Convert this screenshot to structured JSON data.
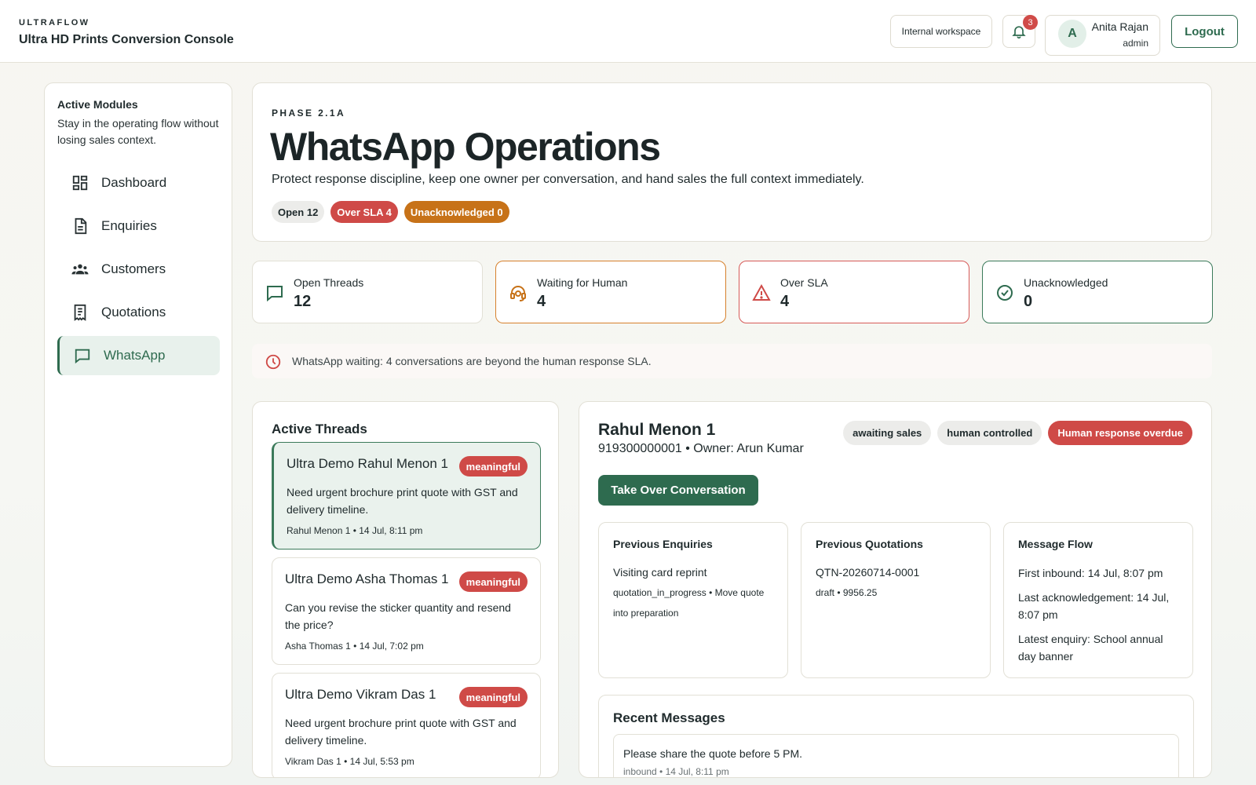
{
  "header": {
    "kicker": "ULTRAFLOW",
    "title": "Ultra HD Prints Conversion Console",
    "workspace": "Internal workspace",
    "notifications_count": "3",
    "user_initial": "A",
    "user_name": "Anita Rajan",
    "user_role": "admin",
    "logout_label": "Logout"
  },
  "sidebar": {
    "title": "Active Modules",
    "description": "Stay in the operating flow without losing sales context.",
    "items": [
      {
        "label": "Dashboard",
        "icon": "dashboard-icon"
      },
      {
        "label": "Enquiries",
        "icon": "document-icon"
      },
      {
        "label": "Customers",
        "icon": "people-icon"
      },
      {
        "label": "Quotations",
        "icon": "receipt-icon"
      },
      {
        "label": "WhatsApp",
        "icon": "chat-icon",
        "active": true
      }
    ]
  },
  "hero": {
    "phase": "PHASE 2.1A",
    "title": "WhatsApp Operations",
    "subtitle": "Protect response discipline, keep one owner per conversation, and hand sales the full context immediately.",
    "pills": {
      "open": "Open 12",
      "over_sla": "Over SLA 4",
      "unacknowledged": "Unacknowledged 0"
    }
  },
  "stats": [
    {
      "label": "Open Threads",
      "value": "12",
      "icon": "chat-icon"
    },
    {
      "label": "Waiting for Human",
      "value": "4",
      "icon": "support-agent-icon"
    },
    {
      "label": "Over SLA",
      "value": "4",
      "icon": "warning-icon"
    },
    {
      "label": "Unacknowledged",
      "value": "0",
      "icon": "check-circle-icon"
    }
  ],
  "alert": {
    "text": "WhatsApp waiting: 4 conversations are beyond the human response SLA."
  },
  "threads": {
    "title": "Active Threads",
    "items": [
      {
        "name": "Ultra Demo Rahul Menon 1",
        "badge": "meaningful",
        "message": "Need urgent brochure print quote with GST and delivery timeline.",
        "meta": "Rahul Menon 1 • 14 Jul, 8:11 pm"
      },
      {
        "name": "Ultra Demo Asha Thomas 1",
        "badge": "meaningful",
        "message": "Can you revise the sticker quantity and resend the price?",
        "meta": "Asha Thomas 1 • 14 Jul, 7:02 pm"
      },
      {
        "name": "Ultra Demo Vikram Das 1",
        "badge": "meaningful",
        "message": "Need urgent brochure print quote with GST and delivery timeline.",
        "meta": "Vikram Das 1 • 14 Jul, 5:53 pm"
      }
    ]
  },
  "detail": {
    "name": "Rahul Menon 1",
    "subline": "919300000001 • Owner: Arun Kumar",
    "tags": {
      "status": "awaiting sales",
      "control": "human controlled",
      "overdue": "Human response overdue"
    },
    "takeover_label": "Take Over Conversation",
    "enquiries": {
      "title": "Previous Enquiries",
      "item": "Visiting card reprint",
      "meta": "quotation_in_progress • Move quote into preparation"
    },
    "quotations": {
      "title": "Previous Quotations",
      "item": "QTN-20260714-0001",
      "meta": "draft • 9956.25"
    },
    "flow": {
      "title": "Message Flow",
      "first_inbound": "First inbound: 14 Jul, 8:07 pm",
      "last_ack": "Last acknowledgement: 14 Jul, 8:07 pm",
      "latest_enquiry": "Latest enquiry: School annual day banner"
    },
    "recent": {
      "title": "Recent Messages",
      "message": "Please share the quote before 5 PM.",
      "meta": "inbound • 14 Jul, 8:11 pm"
    }
  },
  "colors": {
    "accent_green": "#2e6b4f",
    "danger_red": "#cf4a47",
    "warning_orange": "#c77218"
  }
}
